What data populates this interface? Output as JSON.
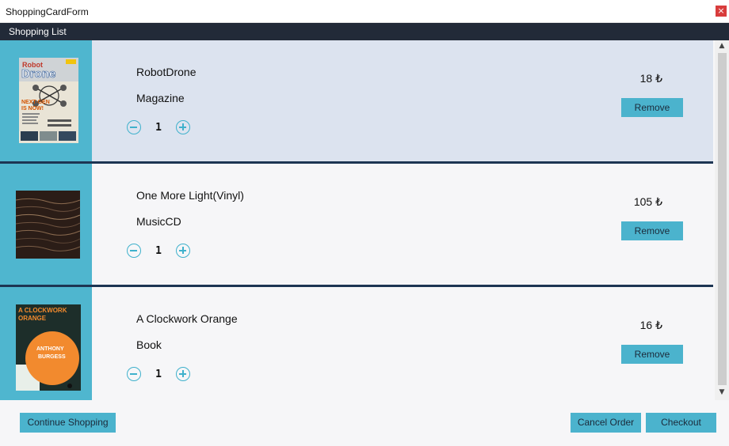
{
  "window": {
    "title": "ShoppingCardForm",
    "close_glyph": "×"
  },
  "menu": {
    "label": "Shopping List"
  },
  "items": [
    {
      "name": "RobotDrone",
      "category": "Magazine",
      "quantity": "1",
      "price": "18 ₺",
      "remove_label": "Remove",
      "image_text": "Robot Drone",
      "image_subtext": "NEXT-GEN IS NOW!"
    },
    {
      "name": "One More Light(Vinyl)",
      "category": "MusicCD",
      "quantity": "1",
      "price": "105 ₺",
      "remove_label": "Remove"
    },
    {
      "name": "A Clockwork Orange",
      "category": "Book",
      "quantity": "1",
      "price": "16 ₺",
      "remove_label": "Remove",
      "image_title": "A CLOCKWORK ORANGE",
      "image_author": "ANTHONY BURGESS"
    }
  ],
  "footer": {
    "continue_label": "Continue Shopping",
    "cancel_label": "Cancel Order",
    "checkout_label": "Checkout"
  },
  "colors": {
    "accent": "#4bb3cd",
    "header_dark": "#222a38",
    "selected_row": "#dce3ef",
    "separator": "#1d3553"
  }
}
